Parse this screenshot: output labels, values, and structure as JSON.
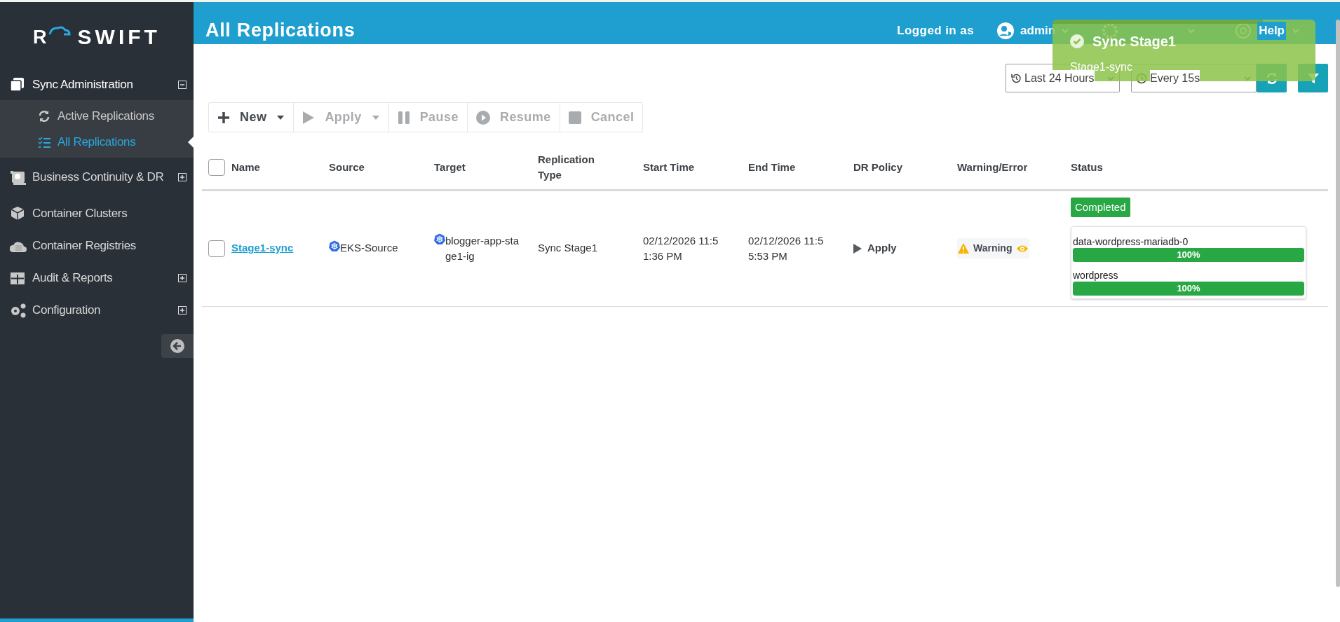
{
  "sidebar": {
    "logo": {
      "mark": "R",
      "text": "SWIFT"
    },
    "items": [
      {
        "label": "Sync Administration",
        "kind": "group",
        "expanded": true,
        "children": [
          {
            "label": "Active Replications",
            "selected": false
          },
          {
            "label": "All Replications",
            "selected": true
          }
        ]
      },
      {
        "label": "Business Continuity & DR",
        "kind": "group",
        "expanded": false
      },
      {
        "label": "Container Clusters",
        "kind": "link"
      },
      {
        "label": "Container Registries",
        "kind": "link"
      },
      {
        "label": "Audit & Reports",
        "kind": "group",
        "expanded": false
      },
      {
        "label": "Configuration",
        "kind": "group",
        "expanded": false
      }
    ]
  },
  "header": {
    "title": "All Replications",
    "logged_in_label": "Logged in as",
    "user": "admin",
    "menus": [
      "Help"
    ]
  },
  "filters": {
    "range": "Last 24 Hours",
    "refresh": "Every 15s"
  },
  "toolbar": [
    {
      "label": "New",
      "disabled": false,
      "dropdown": true
    },
    {
      "label": "Apply",
      "disabled": true,
      "dropdown": true
    },
    {
      "label": "Pause",
      "disabled": true,
      "dropdown": false
    },
    {
      "label": "Resume",
      "disabled": true,
      "dropdown": false
    },
    {
      "label": "Cancel",
      "disabled": true,
      "dropdown": false
    }
  ],
  "table": {
    "select_all": {
      "checked": false
    },
    "columns": [
      "Name",
      "Source",
      "Target",
      "Replication Type",
      "Start Time",
      "End Time",
      "DR Policy",
      "Warning/Error",
      "Status"
    ],
    "rows": [
      {
        "checked": false,
        "name": "Stage1-sync",
        "source": "EKS-Source",
        "target": "blogger-app-stage1-ig",
        "replication_type": "Sync Stage1",
        "start_time": "02/12/2026 11:51:36 PM",
        "end_time": "02/12/2026 11:55:53 PM",
        "dr_policy": "Apply",
        "warning": "Warning",
        "status": "Completed",
        "volumes": [
          {
            "name": "data-wordpress-mariadb-0",
            "level": 1,
            "reading": "100%"
          },
          {
            "name": "wordpress",
            "level": 1,
            "reading": "100%"
          }
        ]
      }
    ]
  },
  "toast": {
    "title": "Sync Stage1",
    "message": "Stage1-sync"
  }
}
